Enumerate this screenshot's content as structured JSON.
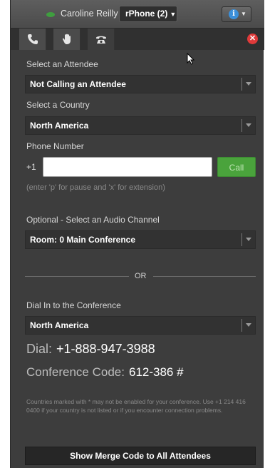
{
  "header": {
    "user_name": "Caroline Reilly",
    "phone_selector": "rPhone (2)",
    "info_icon": "info-icon",
    "status_color": "#3f9e3f"
  },
  "tabs": [
    {
      "icon": "phone-icon"
    },
    {
      "icon": "hand-icon"
    },
    {
      "icon": "telephone-icon",
      "active": true
    }
  ],
  "form": {
    "attendee_label": "Select an Attendee",
    "attendee_value": "Not Calling an Attendee",
    "country_label": "Select a Country",
    "country_value": "North America",
    "phone_label": "Phone Number",
    "phone_prefix": "+1",
    "phone_value": "",
    "call_label": "Call",
    "hint": "(enter 'p' for pause and 'x' for extension)",
    "audio_label": "Optional - Select an Audio Channel",
    "audio_value": "Room: 0 Main Conference"
  },
  "divider": {
    "or_text": "OR"
  },
  "dial_in": {
    "label": "Dial In to the Conference",
    "country_value": "North America",
    "dial_prefix": "Dial:",
    "dial_number": "+1-888-947-3988",
    "code_prefix": "Conference Code:",
    "code_value": "612-386 #",
    "footnote": "Countries marked with * may not be enabled for your conference. Use +1 214 416 0400 if your country is not listed or if you encounter connection problems."
  },
  "merge_button": "Show Merge Code to All Attendees",
  "colors": {
    "panel": "#3d3d3d",
    "call_button": "#4aa33c",
    "close_button": "#e03a3a",
    "info_button": "#3b8fd9"
  }
}
